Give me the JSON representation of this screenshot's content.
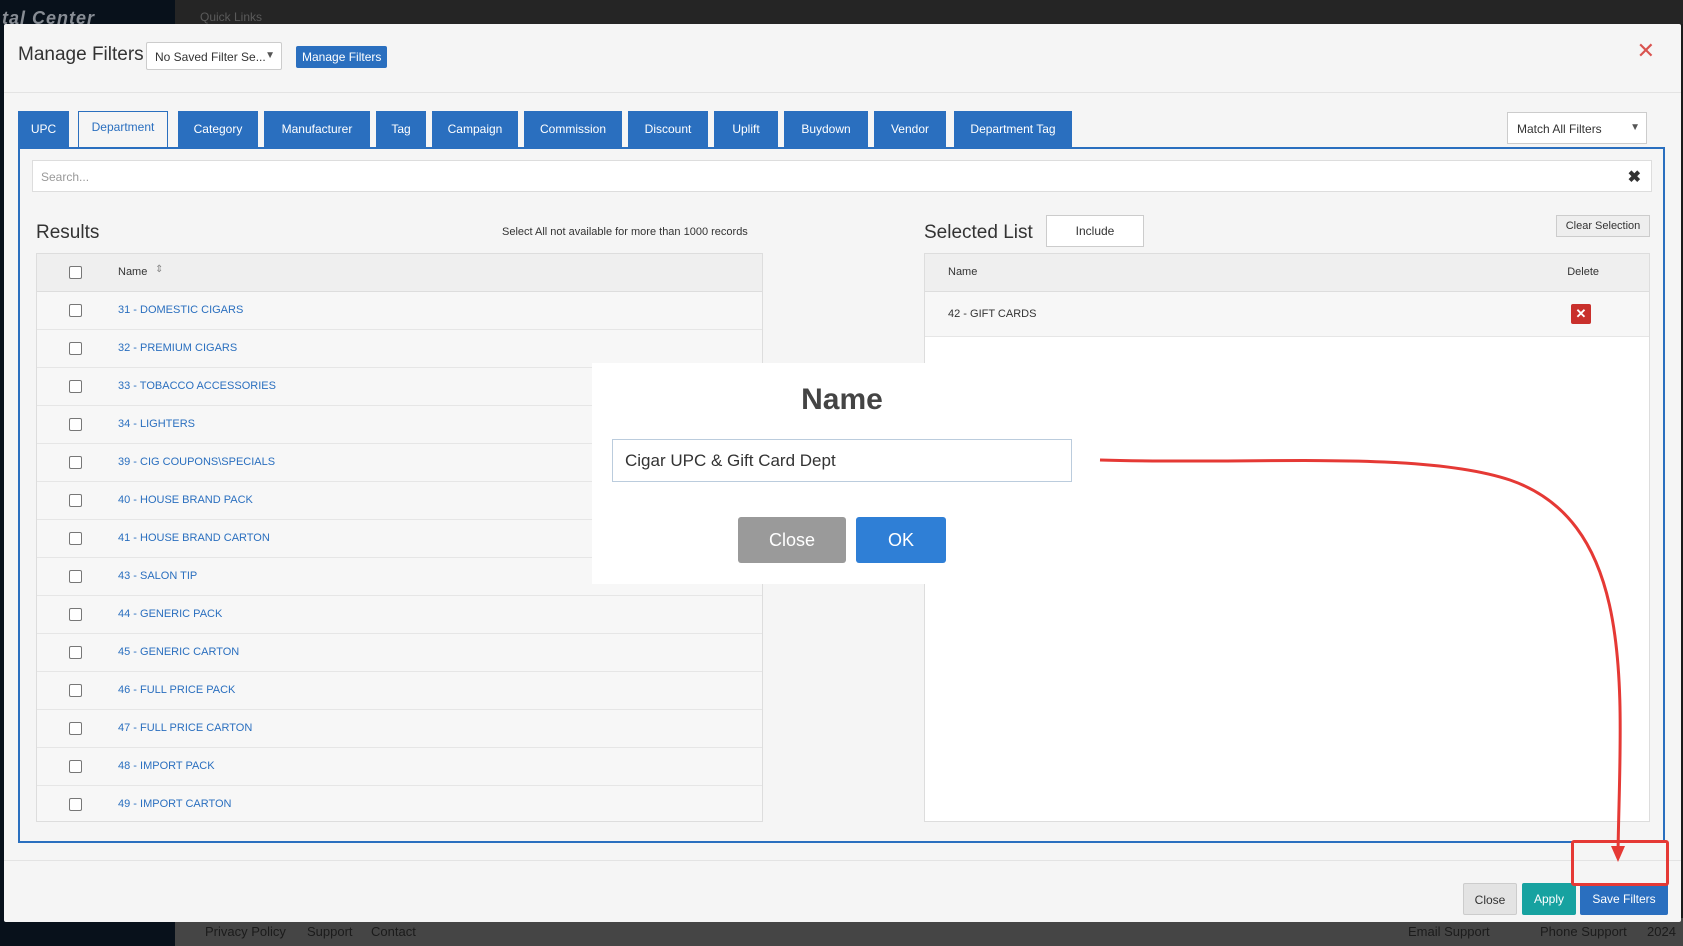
{
  "background": {
    "logo_text": "tal Center",
    "quick_links": "Quick Links",
    "footer": {
      "privacy": "Privacy Policy",
      "support": "Support",
      "contact": "Contact",
      "email_support": "Email Support",
      "phone_support": "Phone Support",
      "year": "2024"
    }
  },
  "modal": {
    "title": "Manage Filters",
    "saved_filter_select": "No Saved Filter Se...",
    "manage_filters_button": "Manage Filters",
    "tabs": [
      {
        "label": "UPC",
        "active": false
      },
      {
        "label": "Department",
        "active": true
      },
      {
        "label": "Category",
        "active": false
      },
      {
        "label": "Manufacturer",
        "active": false
      },
      {
        "label": "Tag",
        "active": false
      },
      {
        "label": "Campaign",
        "active": false
      },
      {
        "label": "Commission",
        "active": false
      },
      {
        "label": "Discount",
        "active": false
      },
      {
        "label": "Uplift",
        "active": false
      },
      {
        "label": "Buydown",
        "active": false
      },
      {
        "label": "Vendor",
        "active": false
      },
      {
        "label": "Department Tag",
        "active": false
      }
    ],
    "match_select": "Match All Filters",
    "search_placeholder": "Search...",
    "results": {
      "title": "Results",
      "note": "Select All not available for more than 1000 records",
      "column_name": "Name",
      "rows": [
        "31 - DOMESTIC CIGARS",
        "32 - PREMIUM CIGARS",
        "33 - TOBACCO ACCESSORIES",
        "34 - LIGHTERS",
        "39 - CIG COUPONS\\SPECIALS",
        "40 - HOUSE BRAND PACK",
        "41 - HOUSE BRAND CARTON",
        "43 - SALON TIP",
        "44 - GENERIC PACK",
        "45 - GENERIC CARTON",
        "46 - FULL PRICE PACK",
        "47 - FULL PRICE CARTON",
        "48 - IMPORT PACK",
        "49 - IMPORT CARTON"
      ]
    },
    "selected": {
      "title": "Selected List",
      "include_button": "Include",
      "clear_selection": "Clear Selection",
      "column_name": "Name",
      "column_delete": "Delete",
      "rows": [
        "42 - GIFT CARDS"
      ]
    },
    "footer": {
      "close": "Close",
      "apply": "Apply",
      "save": "Save Filters"
    }
  },
  "dialog": {
    "title": "Name",
    "input_value": "Cigar UPC & Gift Card Dept",
    "close": "Close",
    "ok": "OK"
  },
  "colors": {
    "primary": "#2a6fbf",
    "apply": "#17a2a0",
    "annotation": "#e53935"
  }
}
